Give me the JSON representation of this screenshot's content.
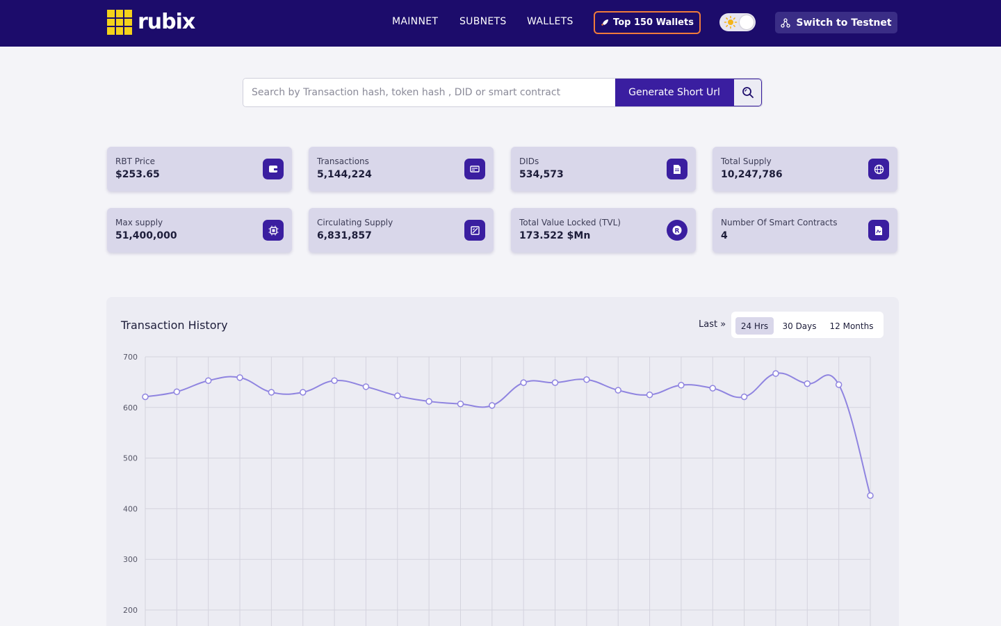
{
  "brand": {
    "name": "rubix",
    "accent": "#f4d21a",
    "header_bg": "#1c0c6b"
  },
  "nav": {
    "items": [
      "MAINNET",
      "SUBNETS",
      "WALLETS"
    ],
    "top_wallets": "Top 150 Wallets",
    "switch_network": "Switch to Testnet"
  },
  "search": {
    "placeholder": "Search by Transaction hash, token hash , DID or smart contract",
    "value": "",
    "short_url_button": "Generate Short Url"
  },
  "stats": [
    {
      "label": "RBT Price",
      "value": "$253.65",
      "icon": "wallet-icon"
    },
    {
      "label": "Transactions",
      "value": "5,144,224",
      "icon": "transactions-icon"
    },
    {
      "label": "DIDs",
      "value": "534,573",
      "icon": "document-icon"
    },
    {
      "label": "Total Supply",
      "value": "10,247,786",
      "icon": "globe-icon"
    },
    {
      "label": "Max supply",
      "value": "51,400,000",
      "icon": "chip-icon"
    },
    {
      "label": "Circulating Supply",
      "value": "6,831,857",
      "icon": "exchange-icon"
    },
    {
      "label": "Total Value Locked (TVL)",
      "value": "173.522 $Mn",
      "icon": "r-coin-icon"
    },
    {
      "label": "Number Of Smart Contracts",
      "value": "4",
      "icon": "contract-file-icon"
    }
  ],
  "chart_panel": {
    "title": "Transaction History",
    "last_label": "Last »",
    "ranges": [
      "24 Hrs",
      "30 Days",
      "12 Months"
    ],
    "active_range": "24 Hrs"
  },
  "chart_data": {
    "type": "line",
    "title": "",
    "xlabel": "",
    "ylabel": "",
    "y_ticks": [
      700,
      600,
      500,
      400,
      300,
      200
    ],
    "ylim": [
      200,
      700
    ],
    "grid": true,
    "series": [
      {
        "values": [
          621,
          631,
          653,
          659,
          630,
          630,
          653,
          641,
          623,
          612,
          607,
          604,
          649,
          649,
          655,
          634,
          625,
          644,
          638,
          621,
          667,
          647,
          645,
          426
        ]
      }
    ],
    "line_color": "#8f84e0"
  }
}
